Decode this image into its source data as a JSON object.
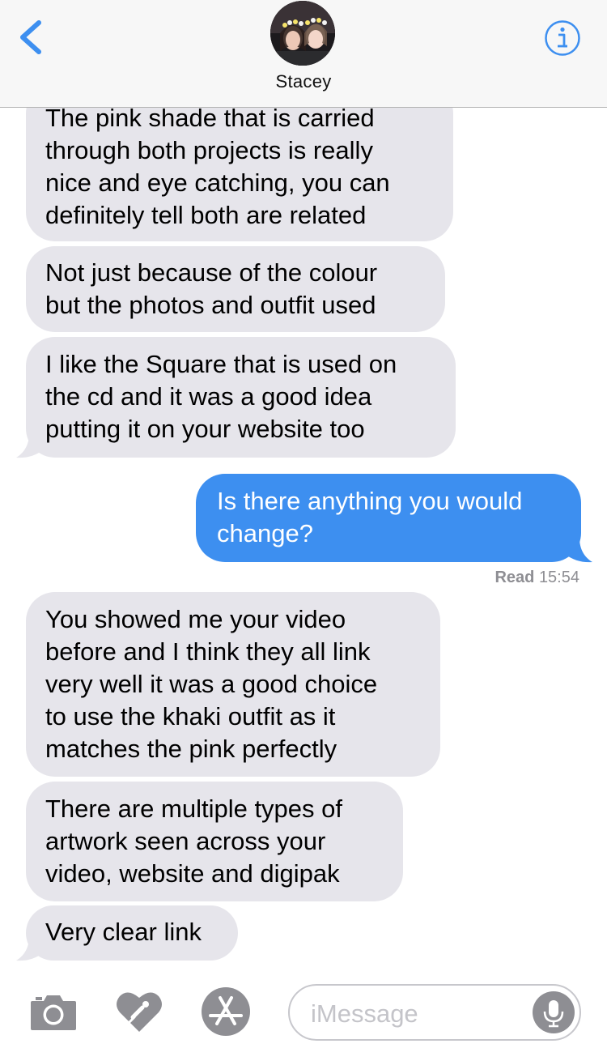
{
  "header": {
    "contact_name": "Stacey"
  },
  "messages": [
    {
      "direction": "received",
      "text": "The pink shade that is carried\nthrough both projects is really\nnice and eye catching, you can\ndefinitely tell both are related"
    },
    {
      "direction": "received",
      "text": "Not just because of the colour\nbut the photos and outfit used"
    },
    {
      "direction": "received",
      "text": "I like the Square that is used on\nthe cd and it was a good idea\nputting it on your website too"
    },
    {
      "direction": "sent",
      "text": "Is there anything you would\nchange?"
    },
    {
      "direction": "received",
      "text": "You showed me your video\nbefore and I think they all link\nvery well it was a good choice\nto use the khaki outfit as it\nmatches the pink perfectly"
    },
    {
      "direction": "received",
      "text": "There are multiple types of\nartwork seen across your\nvideo, website and digipak"
    },
    {
      "direction": "received",
      "text": "Very clear link"
    }
  ],
  "read_receipt": {
    "label": "Read",
    "time": "15:54"
  },
  "input_bar": {
    "placeholder": "iMessage",
    "icons": [
      "camera-icon",
      "digital-touch-icon",
      "app-store-icon",
      "microphone-icon"
    ]
  },
  "colors": {
    "accent": "#3d8ff0",
    "received_bubble": "#e6e5eb",
    "sent_bubble": "#3d8ff0",
    "header_bg": "#f7f7f7",
    "icon_gray": "#8e8e93"
  }
}
